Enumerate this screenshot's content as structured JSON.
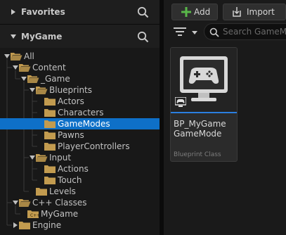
{
  "favorites": {
    "title": "Favorites"
  },
  "project": {
    "title": "MyGame"
  },
  "tree": {
    "items": [
      {
        "label": "All",
        "depth": 0,
        "expanded": true,
        "selected": false,
        "special": "folder-open"
      },
      {
        "label": "Content",
        "depth": 1,
        "expanded": true,
        "selected": false,
        "special": "folder-open"
      },
      {
        "label": "_Game",
        "depth": 2,
        "expanded": true,
        "selected": false,
        "special": "folder-open"
      },
      {
        "label": "Blueprints",
        "depth": 3,
        "expanded": true,
        "selected": false,
        "special": "folder-open"
      },
      {
        "label": "Actors",
        "depth": 4,
        "expanded": false,
        "selected": false,
        "special": "folder"
      },
      {
        "label": "Characters",
        "depth": 4,
        "expanded": false,
        "selected": false,
        "special": "folder"
      },
      {
        "label": "GameModes",
        "depth": 4,
        "expanded": false,
        "selected": true,
        "special": "folder"
      },
      {
        "label": "Pawns",
        "depth": 4,
        "expanded": false,
        "selected": false,
        "special": "folder"
      },
      {
        "label": "PlayerControllers",
        "depth": 4,
        "expanded": false,
        "selected": false,
        "special": "folder"
      },
      {
        "label": "Input",
        "depth": 3,
        "expanded": true,
        "selected": false,
        "special": "folder-open"
      },
      {
        "label": "Actions",
        "depth": 4,
        "expanded": false,
        "selected": false,
        "special": "folder"
      },
      {
        "label": "Touch",
        "depth": 4,
        "expanded": false,
        "selected": false,
        "special": "folder"
      },
      {
        "label": "Levels",
        "depth": 3,
        "expanded": false,
        "selected": false,
        "special": "folder"
      },
      {
        "label": "C++ Classes",
        "depth": 1,
        "expanded": true,
        "selected": false,
        "special": "folder-open"
      },
      {
        "label": "MyGame",
        "depth": 2,
        "expanded": false,
        "selected": false,
        "special": "cpp-folder"
      },
      {
        "label": "Engine",
        "depth": 1,
        "expanded": false,
        "selected": false,
        "special": "collapsed"
      }
    ]
  },
  "toolbar": {
    "add_label": "Add",
    "import_label": "Import",
    "search_placeholder": "Search GameModes"
  },
  "assets": [
    {
      "name": "BP_MyGame GameMode",
      "type": "Blueprint Class"
    }
  ],
  "colors": {
    "folder": "#c29b4f",
    "selection": "#0e70c8",
    "accent_green": "#59b84a",
    "asset_bar": "#2b7fe0"
  }
}
